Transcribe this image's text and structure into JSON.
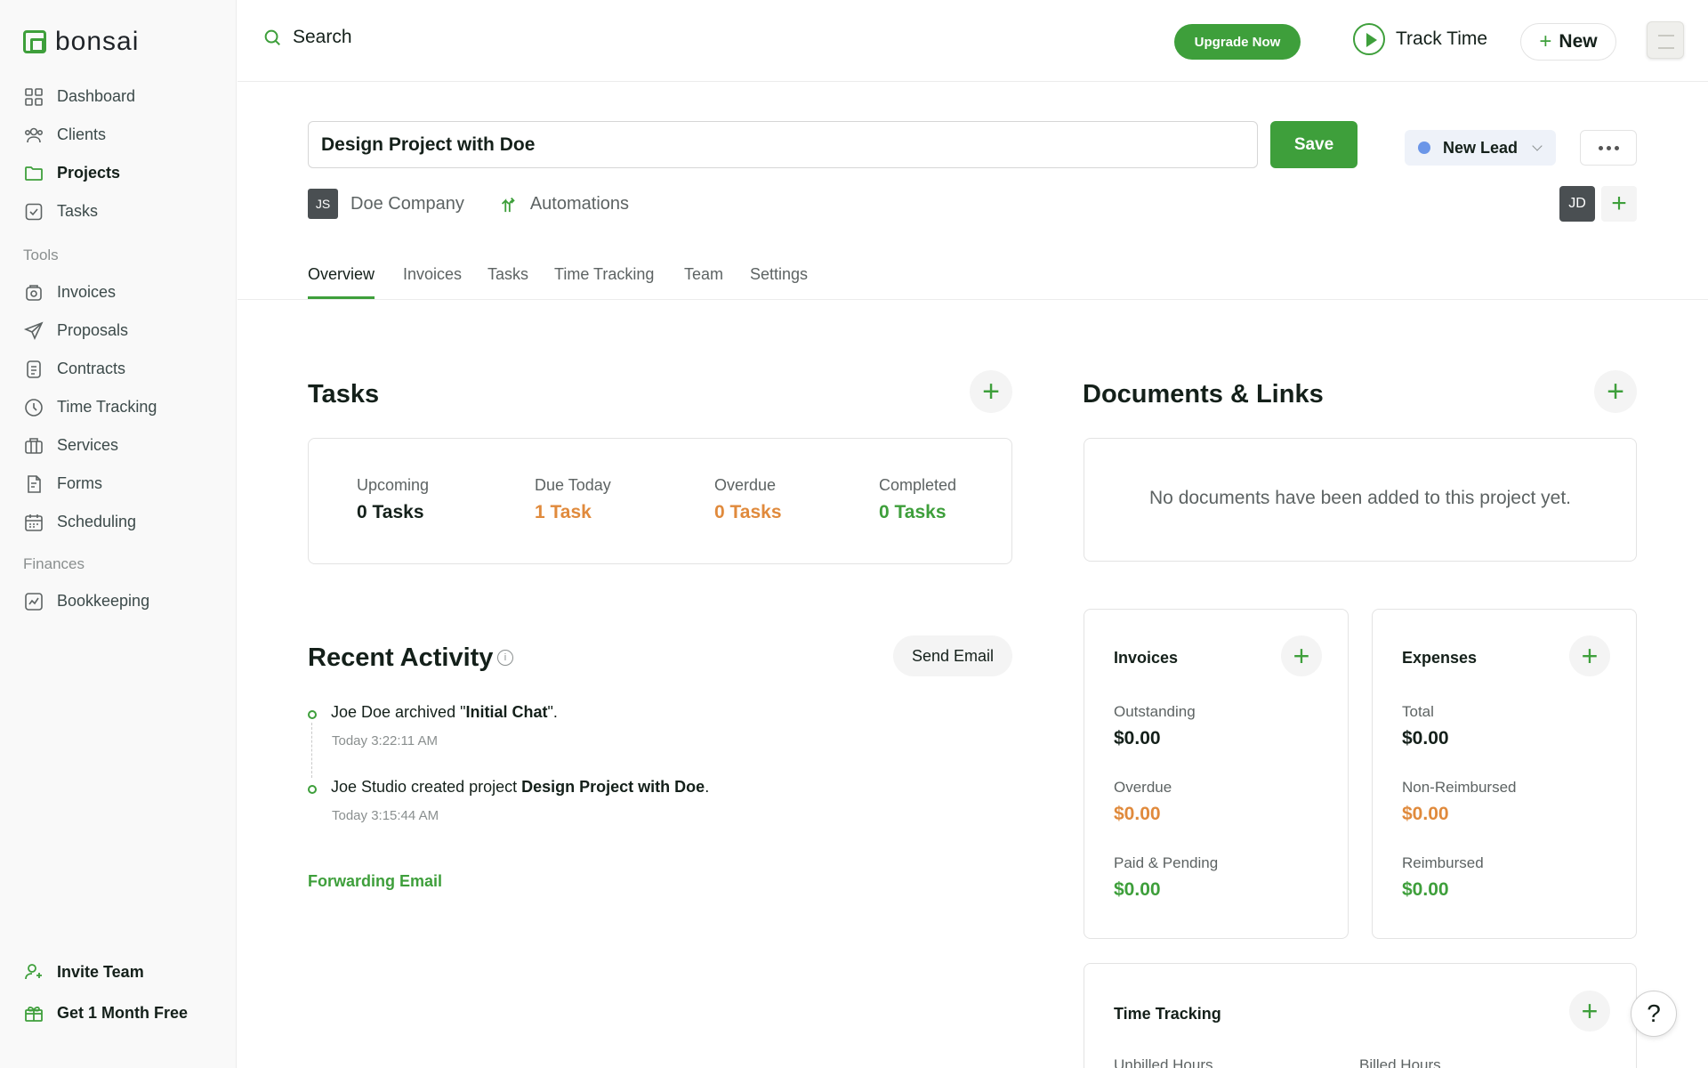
{
  "app": {
    "brand": "bonsai"
  },
  "sidebar": {
    "main_items": [
      {
        "label": "Dashboard",
        "icon": "grid-icon"
      },
      {
        "label": "Clients",
        "icon": "people-icon"
      },
      {
        "label": "Projects",
        "icon": "folder-icon",
        "active": true
      },
      {
        "label": "Tasks",
        "icon": "checkbox-icon"
      }
    ],
    "tools_label": "Tools",
    "tools_items": [
      {
        "label": "Invoices",
        "icon": "invoice-icon"
      },
      {
        "label": "Proposals",
        "icon": "send-icon"
      },
      {
        "label": "Contracts",
        "icon": "document-icon"
      },
      {
        "label": "Time Tracking",
        "icon": "clock-icon"
      },
      {
        "label": "Services",
        "icon": "briefcase-icon"
      },
      {
        "label": "Forms",
        "icon": "form-icon"
      },
      {
        "label": "Scheduling",
        "icon": "calendar-icon"
      }
    ],
    "finances_label": "Finances",
    "finances_items": [
      {
        "label": "Bookkeeping",
        "icon": "chart-icon"
      }
    ],
    "bottom_items": [
      {
        "label": "Invite Team",
        "icon": "add-user-icon"
      },
      {
        "label": "Get 1 Month Free",
        "icon": "gift-icon"
      }
    ]
  },
  "topbar": {
    "search_label": "Search",
    "upgrade_label": "Upgrade Now",
    "track_time_label": "Track Time",
    "new_label": "New"
  },
  "project": {
    "title_value": "Design Project with Doe",
    "save_label": "Save",
    "status_label": "New Lead",
    "client_initials": "JS",
    "client_name": "Doe Company",
    "automations_label": "Automations",
    "member_initials": "JD"
  },
  "tabs": [
    "Overview",
    "Invoices",
    "Tasks",
    "Time Tracking",
    "Team",
    "Settings"
  ],
  "tasks": {
    "heading": "Tasks",
    "stats": [
      {
        "label": "Upcoming",
        "value": "0 Tasks"
      },
      {
        "label": "Due Today",
        "value": "1 Task"
      },
      {
        "label": "Overdue",
        "value": "0 Tasks"
      },
      {
        "label": "Completed",
        "value": "0 Tasks"
      }
    ]
  },
  "documents": {
    "heading": "Documents & Links",
    "empty_text": "No documents have been added to this project yet."
  },
  "activity": {
    "heading": "Recent Activity",
    "send_email_label": "Send Email",
    "items": [
      {
        "pre": "Joe Doe archived \"",
        "bold": "Initial Chat",
        "post": "\".",
        "time": "Today 3:22:11 AM"
      },
      {
        "pre": "Joe Studio created project ",
        "bold": "Design Project with Doe",
        "post": ".",
        "time": "Today 3:15:44 AM"
      }
    ],
    "forwarding_label": "Forwarding Email"
  },
  "invoices_card": {
    "title": "Invoices",
    "rows": [
      {
        "label": "Outstanding",
        "value": "$0.00"
      },
      {
        "label": "Overdue",
        "value": "$0.00"
      },
      {
        "label": "Paid & Pending",
        "value": "$0.00"
      }
    ]
  },
  "expenses_card": {
    "title": "Expenses",
    "rows": [
      {
        "label": "Total",
        "value": "$0.00"
      },
      {
        "label": "Non-Reimbursed",
        "value": "$0.00"
      },
      {
        "label": "Reimbursed",
        "value": "$0.00"
      }
    ]
  },
  "time_tracking_card": {
    "title": "Time Tracking",
    "columns": [
      "Unbilled Hours",
      "Billed Hours"
    ]
  },
  "help_label": "?",
  "colors": {
    "accent_green": "#3e9f3b",
    "warning_orange": "#e08a3c",
    "status_blue": "#6b96e8"
  }
}
